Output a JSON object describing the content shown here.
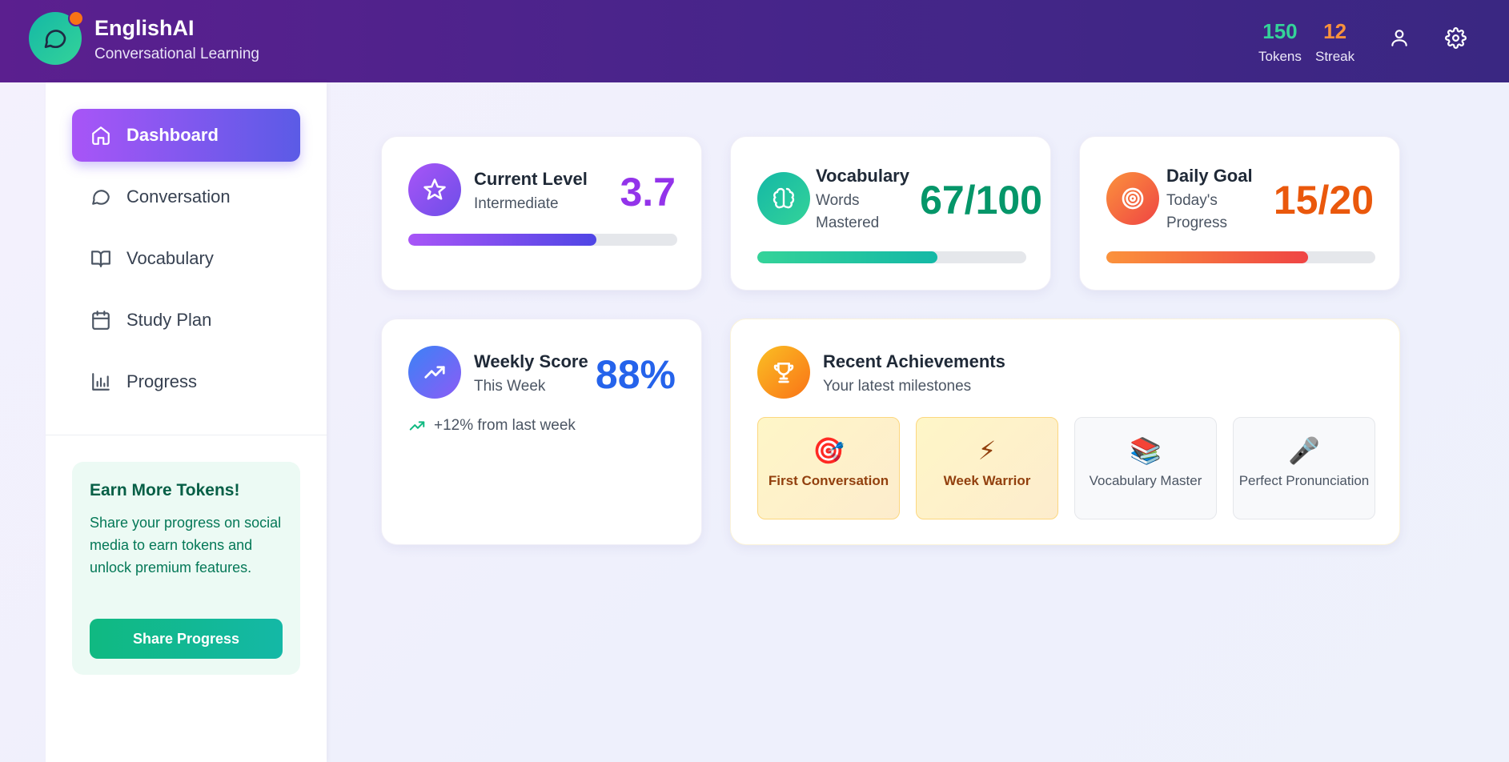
{
  "header": {
    "brand_title": "EnglishAI",
    "brand_subtitle": "Conversational Learning",
    "tokens_value": "150",
    "tokens_label": "Tokens",
    "streak_value": "12",
    "streak_label": "Streak",
    "icons": [
      "chat-bubble-icon",
      "user-icon",
      "gear-icon"
    ]
  },
  "sidebar": {
    "items": [
      {
        "label": "Dashboard",
        "icon": "home-icon",
        "active": true
      },
      {
        "label": "Conversation",
        "icon": "chat-icon",
        "active": false
      },
      {
        "label": "Vocabulary",
        "icon": "book-icon",
        "active": false
      },
      {
        "label": "Study Plan",
        "icon": "calendar-icon",
        "active": false
      },
      {
        "label": "Progress",
        "icon": "bar-chart-icon",
        "active": false
      }
    ],
    "promo": {
      "title": "Earn More Tokens!",
      "text": "Share your progress on social media to earn tokens and unlock premium features.",
      "button": "Share Progress"
    }
  },
  "cards": {
    "level": {
      "title": "Current Level",
      "subtitle": "Intermediate",
      "value": "3.7",
      "progress": 0.7,
      "icon": "star-icon"
    },
    "vocabulary": {
      "title": "Vocabulary",
      "subtitle_line1": "Words",
      "subtitle_line2": "Mastered",
      "value": "67/100",
      "progress": 0.67,
      "icon": "brain-icon"
    },
    "goal": {
      "title": "Daily Goal",
      "subtitle_line1": "Today's",
      "subtitle_line2": "Progress",
      "value": "15/20",
      "progress": 0.75,
      "icon": "target-icon"
    },
    "weekly": {
      "title": "Weekly Score",
      "subtitle": "This Week",
      "value": "88%",
      "change": "+12% from last week",
      "icon": "trending-up-icon"
    },
    "achievements": {
      "title": "Recent Achievements",
      "subtitle": "Your latest milestones",
      "icon": "trophy-icon",
      "items": [
        {
          "label": "First Conversation",
          "emoji": "🎯",
          "earned": true
        },
        {
          "label": "Week Warrior",
          "emoji": "⚡",
          "earned": true
        },
        {
          "label": "Vocabulary Master",
          "emoji": "📚",
          "earned": false
        },
        {
          "label": "Perfect Pronunciation",
          "emoji": "🎤",
          "earned": false
        }
      ]
    }
  },
  "colors": {
    "purple": "#9333ea",
    "green": "#059669",
    "orange": "#ea580c",
    "blue": "#2563eb",
    "tokens": "#34d399",
    "streak": "#fb923c"
  }
}
